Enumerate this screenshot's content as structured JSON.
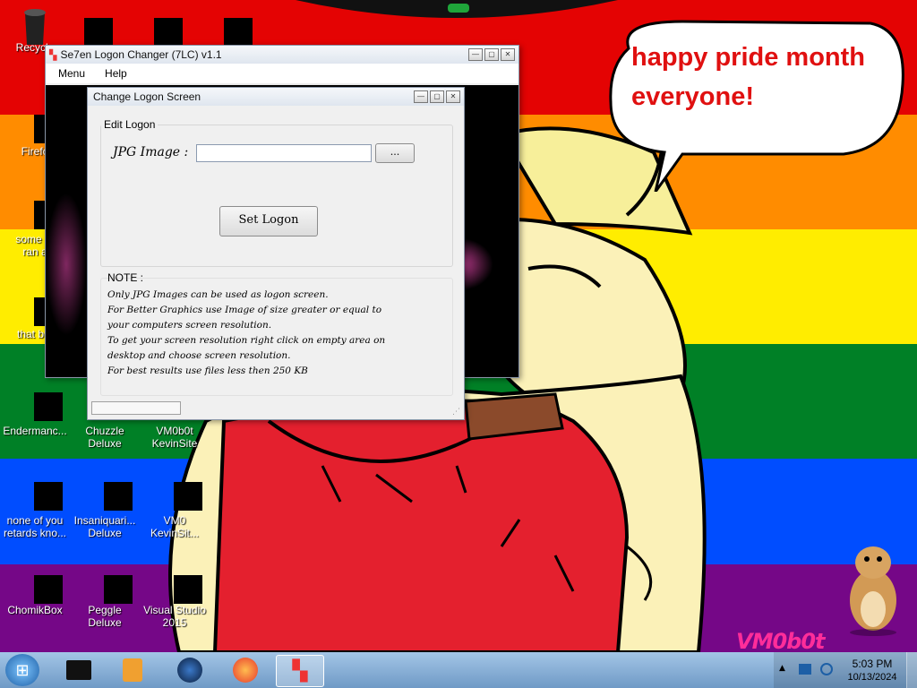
{
  "desktop": {
    "icons": [
      {
        "label": "Recycle"
      },
      {
        "label": "Firefo"
      },
      {
        "label": "some ru\nran a"
      },
      {
        "label": "that but"
      },
      {
        "label": "Endermanc..."
      },
      {
        "label": "Chuzzle\nDeluxe"
      },
      {
        "label": "VM0b0t\nKevinSite"
      },
      {
        "label": "none of you\nretards kno..."
      },
      {
        "label": "Insaniquari...\nDeluxe"
      },
      {
        "label": "VM0\nKevinSit..."
      },
      {
        "label": "ChomikBox"
      },
      {
        "label": "Peggle Deluxe"
      },
      {
        "label": "Visual Studio\n2015"
      }
    ],
    "speech_bubble": "happy pride month\neveryone!",
    "watermark": "VM0b0t"
  },
  "main_window": {
    "title": "Se7en Logon Changer (7LC) v1.1",
    "menu": [
      "Menu",
      "Help"
    ]
  },
  "dialog": {
    "title": "Change Logon Screen",
    "group_label": "Edit Logon",
    "jpg_label": "JPG Image :",
    "jpg_value": "",
    "browse_label": "...",
    "set_logon_label": "Set Logon",
    "note_title": "NOTE :",
    "note_lines": [
      "Only JPG Images can be used as logon screen.",
      "For Better Graphics use Image of size greater or equal to",
      "your computers screen resolution.",
      "To get your screen resolution right click on empty area on",
      "desktop and choose screen resolution.",
      "For best results use files less then 250 KB"
    ]
  },
  "taskbar": {
    "time": "5:03 PM",
    "date": "10/13/2024"
  },
  "colors": {
    "stripes": [
      "#e40303",
      "#ff8c00",
      "#ffed00",
      "#008026",
      "#004dff",
      "#750787"
    ],
    "bubble_text": "#e01010"
  }
}
